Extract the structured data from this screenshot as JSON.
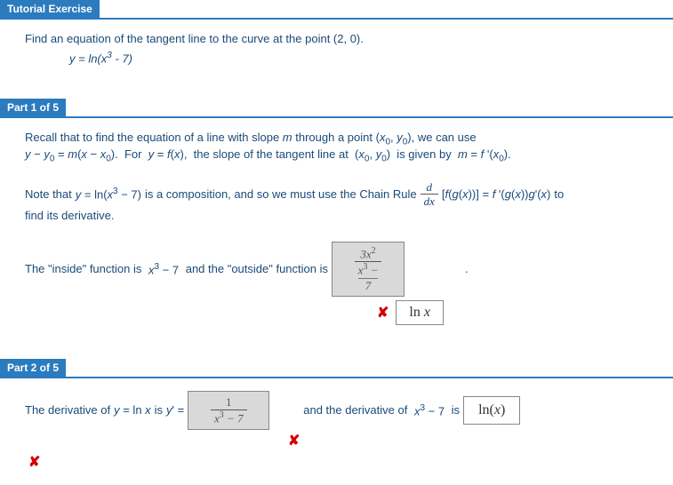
{
  "tutorial": {
    "header": "Tutorial Exercise",
    "prompt": "Find an equation of the tangent line to the curve at the point (2, 0).",
    "equation": "y = ln(x³ - 7)"
  },
  "part1": {
    "header": "Part 1 of 5",
    "line1a": "Recall that to find the equation of a line with slope ",
    "line1_m": "m",
    "line1b": " through a point  (",
    "x0": "x",
    "sub0": "0",
    "comma": ", ",
    "y0": "y",
    "line1c": "),  we can use",
    "line2": "y − y₀ = m(x − x₀).  For  y = f(x),  the slope of the tangent line at  (x₀, y₀)  is given by  m = f '(x₀).",
    "note_a": "Note that  ",
    "note_eq": "y = ln(x³ − 7)",
    "note_b": "  is a composition, and so we must use the Chain Rule  ",
    "chain_num": "d",
    "chain_den": "dx",
    "chain_body": "[f(g(x))] = f '(g(x))g'(x)",
    "note_c": "  to",
    "note_d": "find its derivative.",
    "inside_a": "The \"inside\" function is ",
    "inside_eq": "x³ − 7",
    "inside_b": "  and the \"outside\" function is ",
    "ans1_num": "3x²",
    "ans1_den1": "x³ −",
    "ans1_den2": "7",
    "period": ".",
    "hint1": "ln x"
  },
  "part2": {
    "header": "Part 2 of 5",
    "line_a": "The derivative of  ",
    "line_eq": "y = ln x",
    "line_b": "  is  ",
    "line_yp": "y' = ",
    "ans2_num": "1",
    "ans2_den": "x³ − 7",
    "line_c": "and the derivative of  ",
    "line_eq2": "x³ − 7",
    "line_d": "  is ",
    "hint2": "ln(x)"
  },
  "icons": {
    "wrong": "✘"
  }
}
